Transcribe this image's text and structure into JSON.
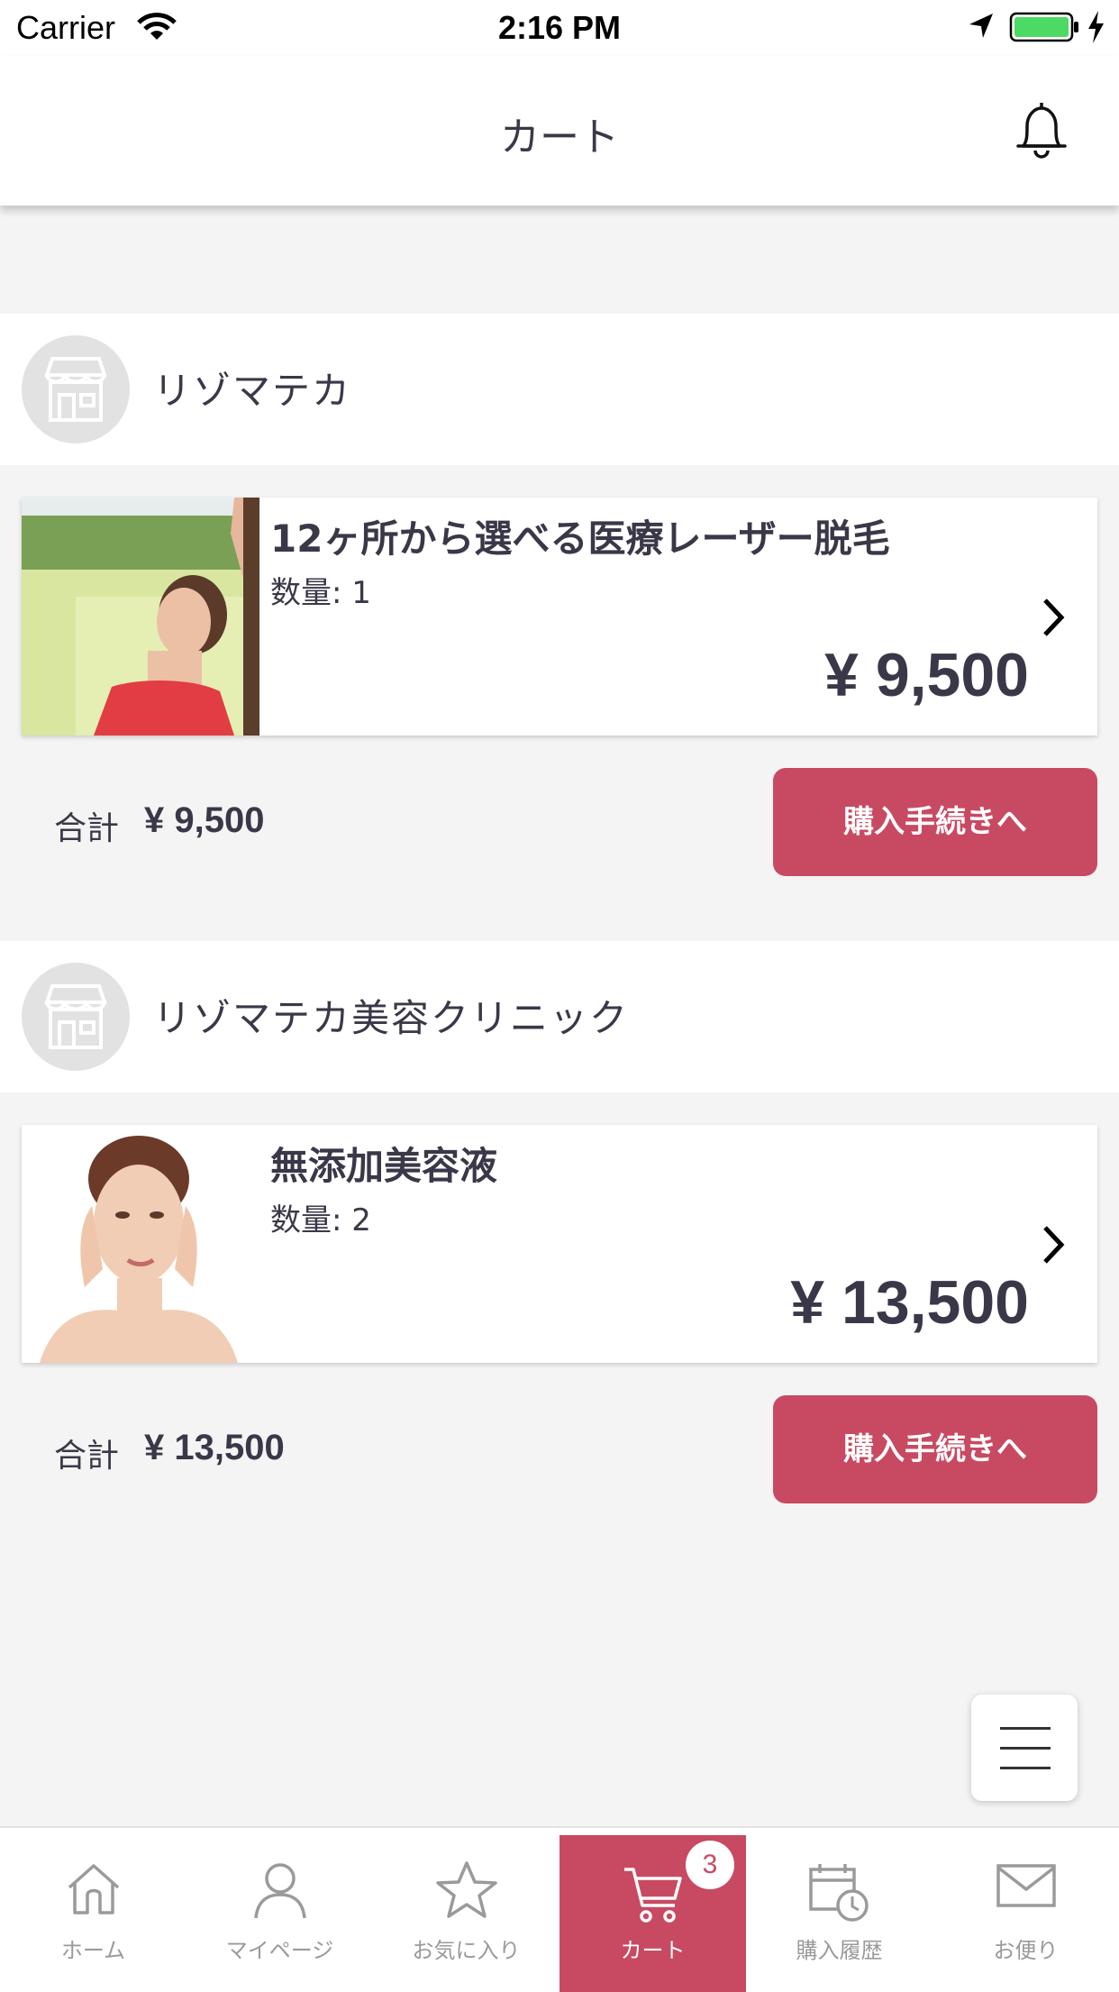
{
  "status_bar": {
    "carrier": "Carrier",
    "time": "2:16 PM"
  },
  "header": {
    "title": "カート"
  },
  "shops": [
    {
      "name": "リゾマテカ",
      "product": {
        "name": "12ヶ所から選べる医療レーザー脱毛",
        "quantity": "数量: 1",
        "price": "¥ 9,500"
      },
      "total_label": "合計",
      "total_value": "¥ 9,500",
      "checkout_label": "購入手続きへ"
    },
    {
      "name": "リゾマテカ美容クリニック",
      "product": {
        "name": "無添加美容液",
        "quantity": "数量: 2",
        "price": "¥ 13,500"
      },
      "total_label": "合計",
      "total_value": "¥ 13,500",
      "checkout_label": "購入手続きへ"
    }
  ],
  "tabbar": {
    "tabs": [
      {
        "label": "ホーム",
        "icon": "home-icon"
      },
      {
        "label": "マイページ",
        "icon": "user-icon"
      },
      {
        "label": "お気に入り",
        "icon": "star-icon"
      },
      {
        "label": "カート",
        "icon": "cart-icon",
        "badge": "3",
        "active": true
      },
      {
        "label": "購入履歴",
        "icon": "calendar-clock-icon"
      },
      {
        "label": "お便り",
        "icon": "mail-icon"
      }
    ]
  },
  "colors": {
    "accent": "#c84a62",
    "text": "#3a3848",
    "background": "#f4f4f4"
  }
}
